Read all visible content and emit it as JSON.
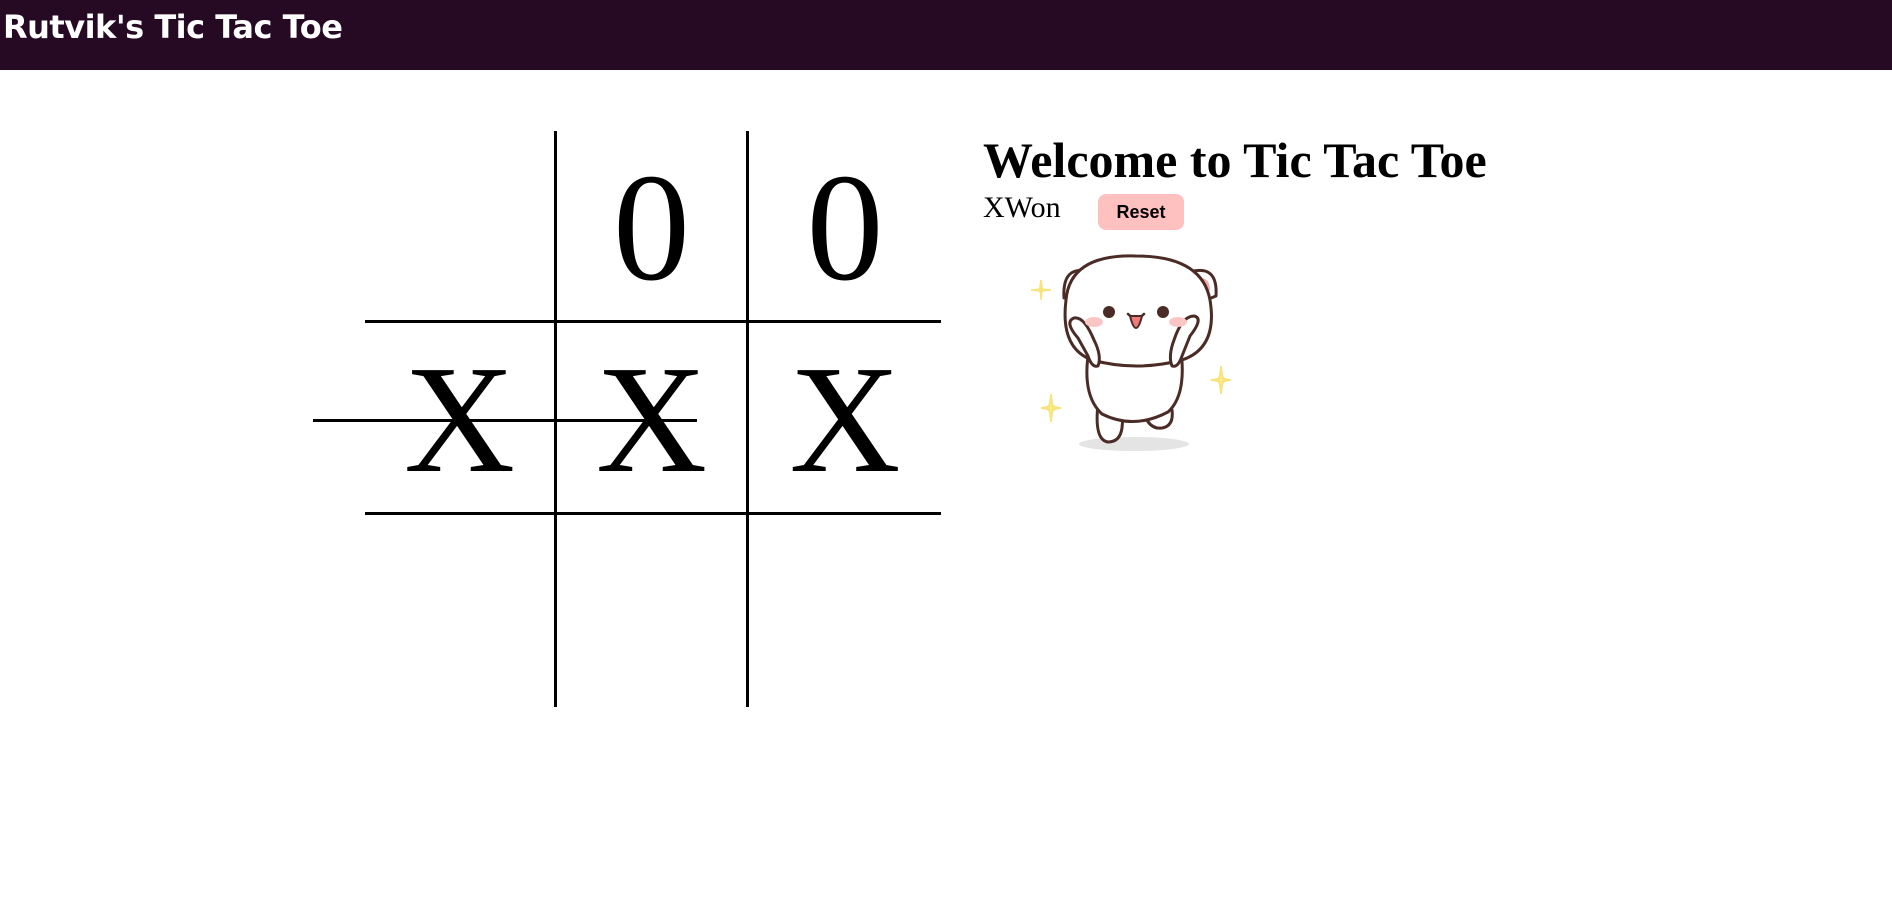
{
  "header": {
    "title": "Rutvik's Tic Tac Toe",
    "background": "#260a24"
  },
  "board": {
    "cells": [
      [
        "",
        "0",
        "0"
      ],
      [
        "X",
        "X",
        "X"
      ],
      [
        "",
        "",
        ""
      ]
    ],
    "winning_row": 1
  },
  "game": {
    "heading": "Welcome to Tic Tac Toe",
    "status": "XWon",
    "reset_label": "Reset",
    "reset_color": "#ffc0c0"
  },
  "image": {
    "icon": "happy-cat-icon"
  }
}
